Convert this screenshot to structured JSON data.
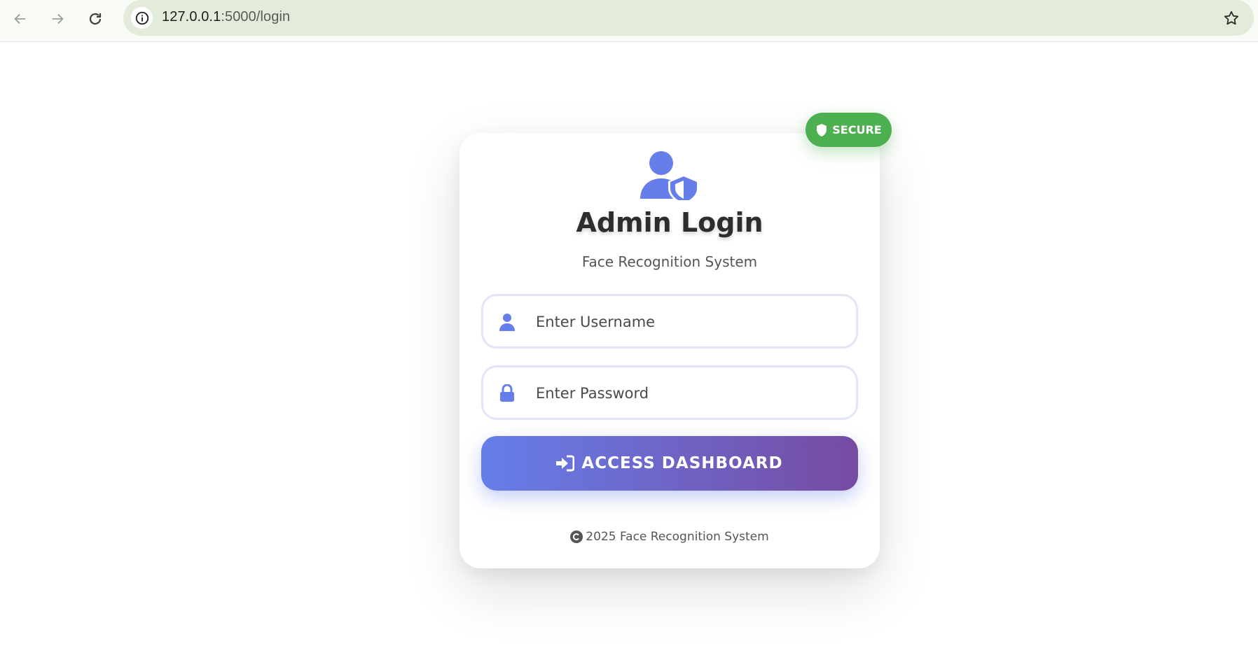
{
  "browser": {
    "url_host": "127.0.0.1",
    "url_path": ":5000/login"
  },
  "badge": {
    "label": "SECURE",
    "color": "#4caf50"
  },
  "login": {
    "title": "Admin Login",
    "subtitle": "Face Recognition System",
    "username_placeholder": "Enter Username",
    "password_placeholder": "Enter Password",
    "submit_label": "ACCESS DASHBOARD"
  },
  "footer": {
    "text": "2025 Face Recognition System"
  },
  "theme": {
    "accent": "#667eea",
    "accent_end": "#764ba2"
  },
  "icons": {
    "back": "arrow-left-icon",
    "forward": "arrow-right-icon",
    "reload": "reload-icon",
    "site_info": "info-icon",
    "bookmark": "star-icon",
    "badge": "shield-icon",
    "header": "user-shield-icon",
    "username": "user-icon",
    "password": "lock-icon",
    "submit": "sign-in-icon",
    "copyright": "copyright-icon"
  }
}
